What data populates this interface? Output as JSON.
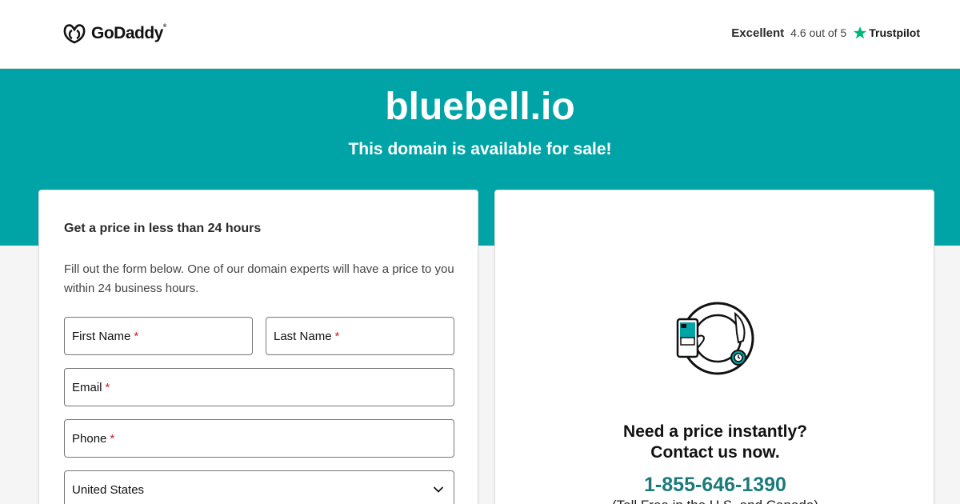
{
  "header": {
    "logo_text": "GoDaddy",
    "logo_tm": "®",
    "trustpilot": {
      "rating_word": "Excellent",
      "score": "4.6 out of 5",
      "brand": "Trustpilot",
      "star_color": "#00b67a"
    }
  },
  "hero": {
    "domain": "bluebell.io",
    "tagline": "This domain is available for sale!",
    "background": "#00a4a6"
  },
  "form": {
    "title": "Get a price in less than 24 hours",
    "description": "Fill out the form below. One of our domain experts will have a price to you within 24 business hours.",
    "required_mark": "*",
    "first_name_label": "First Name",
    "last_name_label": "Last Name",
    "email_label": "Email",
    "phone_label": "Phone",
    "country_value": "United States"
  },
  "contact": {
    "title_line1": "Need a price instantly?",
    "title_line2": "Contact us now.",
    "phone": "1-855-646-1390",
    "toll_free": "(Toll Free in the U.S. and Canada)",
    "accent_color": "#1b7a7c"
  },
  "icons": [
    "godaddy-logo-icon",
    "trustpilot-star-icon",
    "chevron-down-icon",
    "phone-hand-illustration"
  ]
}
